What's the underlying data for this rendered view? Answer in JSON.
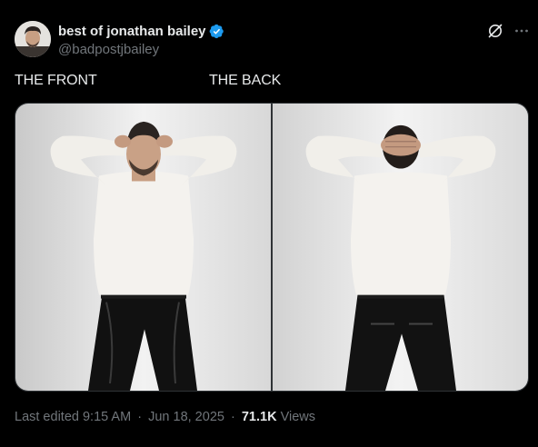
{
  "author": {
    "display_name": "best of jonathan bailey",
    "handle": "@badpostjbailey",
    "verified": true,
    "verified_color": "#1d9bf0"
  },
  "icons": {
    "header_actions": [
      "grok-icon",
      "more-icon"
    ]
  },
  "post": {
    "caption_front": "THE FRONT",
    "caption_back": "THE BACK",
    "media": [
      {
        "name": "front-photo"
      },
      {
        "name": "back-photo"
      }
    ]
  },
  "meta": {
    "edited_label": "Last edited",
    "time": "9:15 AM",
    "separator": "·",
    "date": "Jun 18, 2025",
    "views_count": "71.1K",
    "views_label": "Views"
  },
  "colors": {
    "background": "#000000",
    "text_primary": "#e7e9ea",
    "text_secondary": "#71767b",
    "border": "#2f3336",
    "accent": "#1d9bf0"
  }
}
